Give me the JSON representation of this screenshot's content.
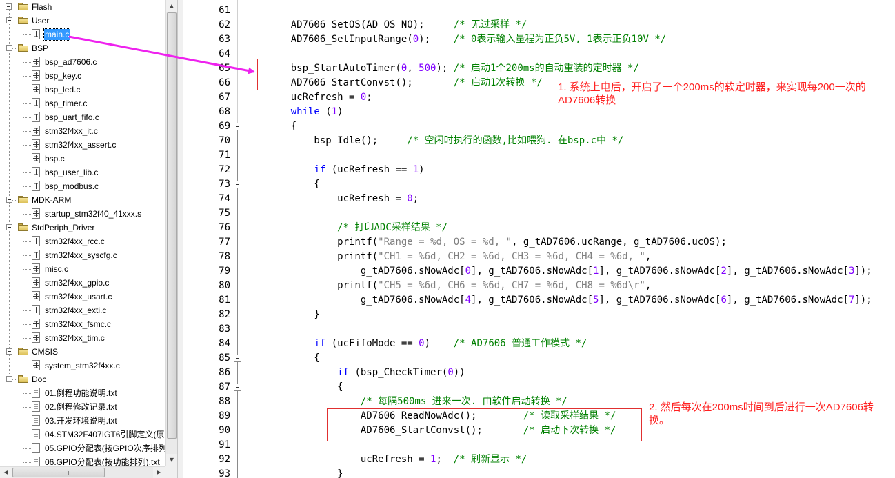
{
  "tree": {
    "items": [
      {
        "label": "Flash",
        "kind": "root"
      },
      {
        "label": "User",
        "kind": "group"
      },
      {
        "label": "main.c",
        "kind": "file",
        "selected": true
      },
      {
        "label": "BSP",
        "kind": "group"
      },
      {
        "label": "bsp_ad7606.c",
        "kind": "file"
      },
      {
        "label": "bsp_key.c",
        "kind": "file"
      },
      {
        "label": "bsp_led.c",
        "kind": "file"
      },
      {
        "label": "bsp_timer.c",
        "kind": "file"
      },
      {
        "label": "bsp_uart_fifo.c",
        "kind": "file"
      },
      {
        "label": "stm32f4xx_it.c",
        "kind": "file"
      },
      {
        "label": "stm32f4xx_assert.c",
        "kind": "file"
      },
      {
        "label": "bsp.c",
        "kind": "file"
      },
      {
        "label": "bsp_user_lib.c",
        "kind": "file"
      },
      {
        "label": "bsp_modbus.c",
        "kind": "file"
      },
      {
        "label": "MDK-ARM",
        "kind": "group"
      },
      {
        "label": "startup_stm32f40_41xxx.s",
        "kind": "file"
      },
      {
        "label": "StdPeriph_Driver",
        "kind": "group"
      },
      {
        "label": "stm32f4xx_rcc.c",
        "kind": "file"
      },
      {
        "label": "stm32f4xx_syscfg.c",
        "kind": "file"
      },
      {
        "label": "misc.c",
        "kind": "file"
      },
      {
        "label": "stm32f4xx_gpio.c",
        "kind": "file"
      },
      {
        "label": "stm32f4xx_usart.c",
        "kind": "file"
      },
      {
        "label": "stm32f4xx_exti.c",
        "kind": "file"
      },
      {
        "label": "stm32f4xx_fsmc.c",
        "kind": "file"
      },
      {
        "label": "stm32f4xx_tim.c",
        "kind": "file"
      },
      {
        "label": "CMSIS",
        "kind": "group"
      },
      {
        "label": "system_stm32f4xx.c",
        "kind": "file"
      },
      {
        "label": "Doc",
        "kind": "group"
      },
      {
        "label": "01.例程功能说明.txt",
        "kind": "txt"
      },
      {
        "label": "02.例程修改记录.txt",
        "kind": "txt"
      },
      {
        "label": "03.开发环境说明.txt",
        "kind": "txt"
      },
      {
        "label": "04.STM32F407IGT6引脚定义(原",
        "kind": "txt"
      },
      {
        "label": "05.GPIO分配表(按GPIO次序排列",
        "kind": "txt"
      },
      {
        "label": "06.GPIO分配表(按功能排列).txt",
        "kind": "txt"
      }
    ]
  },
  "editor": {
    "lines": [
      {
        "n": "61",
        "t": []
      },
      {
        "n": "62",
        "t": [
          [
            "    AD7606_SetOS(AD_OS_NO);     ",
            ""
          ],
          [
            "/* 无过采样 */",
            "cmt"
          ]
        ]
      },
      {
        "n": "63",
        "t": [
          [
            "    AD7606_SetInputRange(",
            ""
          ],
          [
            "0",
            "num"
          ],
          [
            ");    ",
            ""
          ],
          [
            "/* 0表示输入量程为正负5V, 1表示正负10V */",
            "cmt"
          ]
        ]
      },
      {
        "n": "64",
        "t": []
      },
      {
        "n": "65",
        "t": [
          [
            "    bsp_StartAutoTimer(",
            ""
          ],
          [
            "0",
            "num"
          ],
          [
            ", ",
            ""
          ],
          [
            "500",
            "num"
          ],
          [
            ");",
            ""
          ],
          [
            " /* 启动1个200ms的自动重装的定时器 */",
            "cmt"
          ]
        ]
      },
      {
        "n": "66",
        "t": [
          [
            "    AD7606_StartConvst();       ",
            ""
          ],
          [
            "/* 启动1次转换 */",
            "cmt"
          ]
        ]
      },
      {
        "n": "67",
        "t": [
          [
            "    ucRefresh = ",
            ""
          ],
          [
            "0",
            "num"
          ],
          [
            ";",
            ""
          ]
        ]
      },
      {
        "n": "68",
        "t": [
          [
            "    ",
            ""
          ],
          [
            "while",
            "kw"
          ],
          [
            " (",
            ""
          ],
          [
            "1",
            "num"
          ],
          [
            ")",
            ""
          ]
        ]
      },
      {
        "n": "69",
        "t": [
          [
            "    {",
            ""
          ]
        ],
        "fold": true
      },
      {
        "n": "70",
        "t": [
          [
            "        bsp_Idle();     ",
            ""
          ],
          [
            "/* 空闲时执行的函数,比如喂狗. 在bsp.c中 */",
            "cmt"
          ]
        ]
      },
      {
        "n": "71",
        "t": []
      },
      {
        "n": "72",
        "t": [
          [
            "        ",
            ""
          ],
          [
            "if",
            "kw"
          ],
          [
            " (ucRefresh == ",
            ""
          ],
          [
            "1",
            "num"
          ],
          [
            ")",
            ""
          ]
        ]
      },
      {
        "n": "73",
        "t": [
          [
            "        {",
            ""
          ]
        ],
        "fold": true
      },
      {
        "n": "74",
        "t": [
          [
            "            ucRefresh = ",
            ""
          ],
          [
            "0",
            "num"
          ],
          [
            ";",
            ""
          ]
        ]
      },
      {
        "n": "75",
        "t": []
      },
      {
        "n": "76",
        "t": [
          [
            "            ",
            ""
          ],
          [
            "/* 打印ADC采样结果 */",
            "cmt"
          ]
        ]
      },
      {
        "n": "77",
        "t": [
          [
            "            printf(",
            ""
          ],
          [
            "\"Range = %d, OS = %d, \"",
            "str"
          ],
          [
            ", g_tAD7606.ucRange, g_tAD7606.ucOS);",
            ""
          ]
        ]
      },
      {
        "n": "78",
        "t": [
          [
            "            printf(",
            ""
          ],
          [
            "\"CH1 = %6d, CH2 = %6d, CH3 = %6d, CH4 = %6d, \"",
            "str"
          ],
          [
            ",",
            ""
          ]
        ]
      },
      {
        "n": "79",
        "t": [
          [
            "                g_tAD7606.sNowAdc[",
            ""
          ],
          [
            "0",
            "num"
          ],
          [
            "], g_tAD7606.sNowAdc[",
            ""
          ],
          [
            "1",
            "num"
          ],
          [
            "], g_tAD7606.sNowAdc[",
            ""
          ],
          [
            "2",
            "num"
          ],
          [
            "], g_tAD7606.sNowAdc[",
            ""
          ],
          [
            "3",
            "num"
          ],
          [
            "]);",
            ""
          ]
        ]
      },
      {
        "n": "80",
        "t": [
          [
            "            printf(",
            ""
          ],
          [
            "\"CH5 = %6d, CH6 = %6d, CH7 = %6d, CH8 = %6d\\r\"",
            "str"
          ],
          [
            ",",
            ""
          ]
        ]
      },
      {
        "n": "81",
        "t": [
          [
            "                g_tAD7606.sNowAdc[",
            ""
          ],
          [
            "4",
            "num"
          ],
          [
            "], g_tAD7606.sNowAdc[",
            ""
          ],
          [
            "5",
            "num"
          ],
          [
            "], g_tAD7606.sNowAdc[",
            ""
          ],
          [
            "6",
            "num"
          ],
          [
            "], g_tAD7606.sNowAdc[",
            ""
          ],
          [
            "7",
            "num"
          ],
          [
            "]);",
            ""
          ]
        ]
      },
      {
        "n": "82",
        "t": [
          [
            "        }",
            ""
          ]
        ]
      },
      {
        "n": "83",
        "t": []
      },
      {
        "n": "84",
        "t": [
          [
            "        ",
            ""
          ],
          [
            "if",
            "kw"
          ],
          [
            " (ucFifoMode == ",
            ""
          ],
          [
            "0",
            "num"
          ],
          [
            ")    ",
            ""
          ],
          [
            "/* AD7606 普通工作模式 */",
            "cmt"
          ]
        ]
      },
      {
        "n": "85",
        "t": [
          [
            "        {",
            ""
          ]
        ],
        "fold": true
      },
      {
        "n": "86",
        "t": [
          [
            "            ",
            ""
          ],
          [
            "if",
            "kw"
          ],
          [
            " (bsp_CheckTimer(",
            ""
          ],
          [
            "0",
            "num"
          ],
          [
            "))",
            ""
          ]
        ]
      },
      {
        "n": "87",
        "t": [
          [
            "            {",
            ""
          ]
        ],
        "fold": true
      },
      {
        "n": "88",
        "t": [
          [
            "                ",
            ""
          ],
          [
            "/* 每隔500ms 进来一次. 由软件启动转换 */",
            "cmt"
          ]
        ]
      },
      {
        "n": "89",
        "t": [
          [
            "                AD7606_ReadNowAdc();        ",
            ""
          ],
          [
            "/* 读取采样结果 */",
            "cmt"
          ]
        ]
      },
      {
        "n": "90",
        "t": [
          [
            "                AD7606_StartConvst();       ",
            ""
          ],
          [
            "/* 启动下次转换 */",
            "cmt"
          ]
        ]
      },
      {
        "n": "91",
        "t": []
      },
      {
        "n": "92",
        "t": [
          [
            "                ucRefresh = ",
            ""
          ],
          [
            "1",
            "num"
          ],
          [
            ";  ",
            ""
          ],
          [
            "/* 刷新显示 */",
            "cmt"
          ]
        ]
      },
      {
        "n": "93",
        "t": [
          [
            "            }",
            ""
          ]
        ]
      }
    ]
  },
  "annotations": {
    "note1_line1": "1. 系统上电后，开启了一个200ms的软定时器，来实现每200一次的",
    "note1_line2": "AD7606转换",
    "note2_line1": "2. 然后每次在200ms时间到后进行一次AD7606转",
    "note2_line2": "换。",
    "arrow_color": "#ee22ee",
    "box_color": "#e03030"
  }
}
